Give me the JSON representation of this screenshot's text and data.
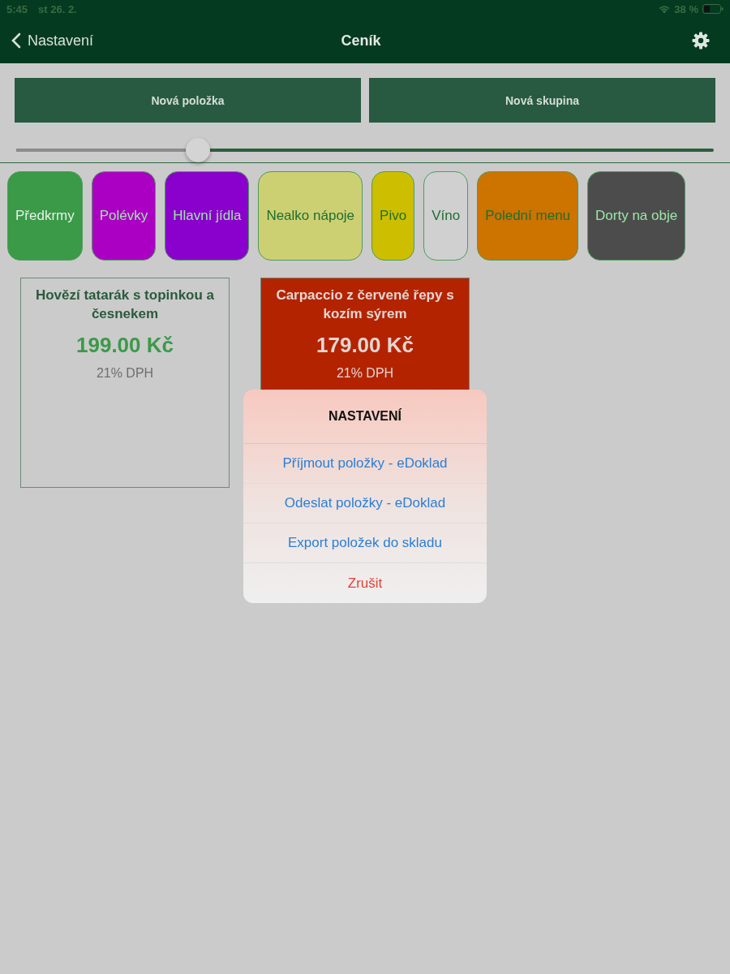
{
  "status_bar": {
    "time": "5:45",
    "date": "st 26. 2.",
    "battery": "38 %"
  },
  "nav": {
    "back": "Nastavení",
    "title": "Ceník"
  },
  "buttons": [
    "Nová položka",
    "Nová skupina"
  ],
  "slider": {
    "level": 0.26
  },
  "categories": [
    {
      "label": "Předkrmy",
      "color": "#3a9a48",
      "selected": true
    },
    {
      "label": "Polévky",
      "color": "#ab00c4",
      "selected": false
    },
    {
      "label": "Hlavní jídla",
      "color": "#8a00cc",
      "selected": false
    },
    {
      "label": "Nealko nápoje",
      "color": "#cdd072",
      "selected": false
    },
    {
      "label": "Pivo",
      "color": "#cdbf00",
      "selected": false
    },
    {
      "label": "Víno",
      "color": "#d0d0d0",
      "selected": false
    },
    {
      "label": "Polední menu",
      "color": "#cc7300",
      "selected": false
    },
    {
      "label": "Dorty na obje",
      "color": "#4c4c4c",
      "selected": false
    }
  ],
  "items": [
    {
      "title": "Hovězí tatarák s topinkou a česnekem",
      "price": "199.00 Kč",
      "vat": "21% DPH",
      "color": "#cbcbcb"
    },
    {
      "title": "Carpaccio z červené řepy s kozím sýrem",
      "price": "179.00 Kč",
      "vat": "21% DPH",
      "color": "#b42300"
    }
  ],
  "action_sheet": {
    "title": "NASTAVENÍ",
    "actions": [
      {
        "label": "Příjmout položky - eDoklad",
        "kind": "default"
      },
      {
        "label": "Odeslat položky - eDoklad",
        "kind": "default"
      },
      {
        "label": "Export položek do skladu",
        "kind": "default"
      },
      {
        "label": "Zrušit",
        "kind": "destructive"
      }
    ]
  }
}
